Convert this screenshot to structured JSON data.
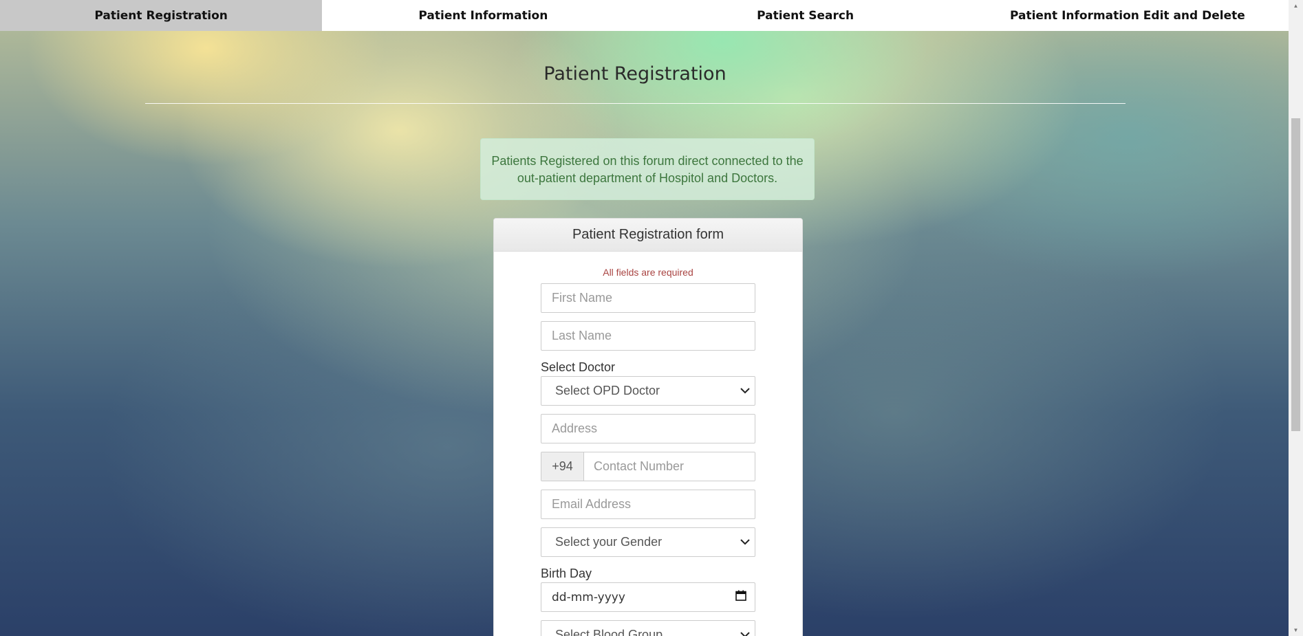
{
  "nav": {
    "items": [
      {
        "label": "Patient Registration",
        "active": true
      },
      {
        "label": "Patient Information",
        "active": false
      },
      {
        "label": "Patient Search",
        "active": false
      },
      {
        "label": "Patient Information Edit and Delete",
        "active": false
      }
    ]
  },
  "page": {
    "title": "Patient Registration"
  },
  "alert": {
    "line1": "Patients Registered on this forum direct connected to the",
    "line2": "out-patient department of Hospitol and Doctors."
  },
  "form": {
    "heading": "Patient Registration form",
    "required_note": "All fields are required",
    "first_name_placeholder": "First Name",
    "last_name_placeholder": "Last Name",
    "doctor_label": "Select Doctor",
    "doctor_select_value": "Select OPD Doctor",
    "address_placeholder": "Address",
    "phone_prefix": "+94",
    "contact_placeholder": "Contact Number",
    "email_placeholder": "Email Address",
    "gender_select_value": "Select your Gender",
    "birthday_label": "Birth Day",
    "birthday_placeholder": "dd-mm-yyyy",
    "blood_group_select_value": "Select Blood Group"
  },
  "colors": {
    "nav_active_bg": "#c8c8c8",
    "alert_text": "#3c763d",
    "alert_bg": "#d4edda",
    "required_text": "#a94442"
  },
  "icons": {
    "select_chevron": "chevron-down-icon",
    "date_picker": "calendar-icon"
  }
}
